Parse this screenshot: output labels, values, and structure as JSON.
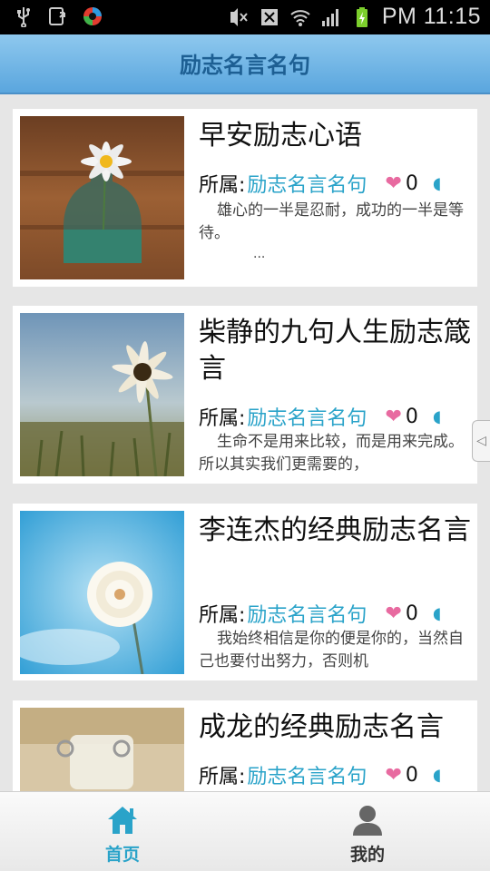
{
  "status_bar": {
    "time": "PM 11:15",
    "left_icons": [
      "usb-icon",
      "download-icon",
      "app-notification-icon"
    ],
    "right_icons": [
      "mute-icon",
      "no-sim-icon",
      "wifi-icon",
      "signal-icon",
      "battery-charging-icon"
    ]
  },
  "header": {
    "title": "励志名言名句"
  },
  "articles": [
    {
      "title": "早安励志心语",
      "meta_prefix": "所属:",
      "category": "励志名言名句",
      "likes": "0",
      "excerpt": "雄心的一半是忍耐，成功的一半是等待。",
      "more": "..."
    },
    {
      "title": "柴静的九句人生励志箴言",
      "meta_prefix": "所属:",
      "category": "励志名言名句",
      "likes": "0",
      "excerpt": "生命不是用来比较，而是用来完成。所以其实我们更需要的，"
    },
    {
      "title": "李连杰的经典励志名言",
      "meta_prefix": "所属:",
      "category": "励志名言名句",
      "likes": "0",
      "excerpt": "我始终相信是你的便是你的，当然自己也要付出努力，否则机"
    },
    {
      "title": "成龙的经典励志名言",
      "meta_prefix": "所属:",
      "category": "励志名言名句",
      "likes": "0",
      "excerpt": ""
    }
  ],
  "bottom_nav": {
    "home_label": "首页",
    "me_label": "我的"
  },
  "colors": {
    "accent": "#2aa3c9",
    "header": "#5aa6de",
    "heart": "#e86aa0"
  }
}
